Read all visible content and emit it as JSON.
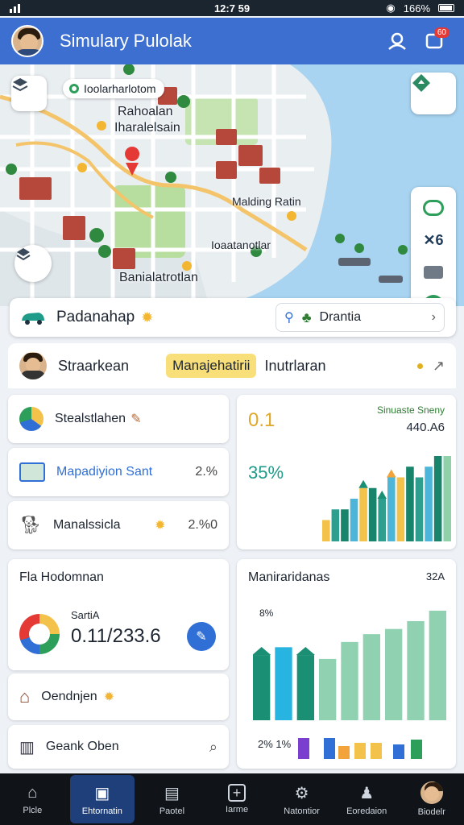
{
  "status": {
    "time": "12:7 59",
    "battery": "166%"
  },
  "header": {
    "title": "Simulary Pulolak",
    "notification_count": "60"
  },
  "map": {
    "chip_label": "Ioolarharlotom",
    "labels": [
      "Rahoalan",
      "Iharalelsain",
      "Malding Ratin",
      "Ioaatanotlar",
      "Banialatrotlan"
    ]
  },
  "location": {
    "name": "Padanahap",
    "destination": "Drantia"
  },
  "profile": {
    "name": "Straarkean",
    "pill": "Manajehatirii",
    "tag": "Inutrlaran"
  },
  "rows": [
    {
      "label": "Stealstlahen",
      "value": ""
    },
    {
      "label": "Mapadiyion Sant",
      "value": "2.%"
    },
    {
      "label": "Manalssicla",
      "value": "2.%0"
    }
  ],
  "stats_card": {
    "value": "0.1",
    "legend_label": "Sinuaste Sneny",
    "legend_value": "440.A6",
    "percent": "35%"
  },
  "summary_card": {
    "title": "Fla Hodomnan",
    "sublabel": "SartiA",
    "value": "0.11/233.6"
  },
  "list_items": [
    {
      "label": "Oendnjen"
    },
    {
      "label": "Geank Oben"
    }
  ],
  "chart_card": {
    "title": "Maniraridanas",
    "corner": "32A",
    "top_label": "8%",
    "bottom_label": "2% 1%"
  },
  "chart_data": [
    {
      "type": "bar",
      "series": [
        {
          "values": [
            2,
            3,
            3,
            4,
            5,
            5,
            4,
            6,
            6,
            7,
            6,
            7,
            8,
            8
          ]
        }
      ],
      "colors": [
        "#f2c24b",
        "#2e9e8f",
        "#18846b",
        "#4db6d8",
        "#f2c24b",
        "#18846b",
        "#2e9e8f",
        "#4db6d8",
        "#f2c24b",
        "#18846b",
        "#2e9e8f",
        "#4db6d8",
        "#18846b",
        "#8fd1a9"
      ]
    },
    {
      "type": "bar",
      "series": [
        {
          "values": [
            5,
            5.6,
            5,
            4.7,
            6,
            6.6,
            7,
            7.6,
            8.4
          ]
        }
      ],
      "colors": [
        "#1b8f74",
        "#28b4e0",
        "#1b8f74",
        "#8fd1b0",
        "#8fd1b0",
        "#8fd1b0",
        "#8fd1b0",
        "#8fd1b0",
        "#8fd1b0"
      ]
    }
  ],
  "nav": [
    {
      "label": "Plcle"
    },
    {
      "label": "Ehtornatin"
    },
    {
      "label": "Paotel"
    },
    {
      "label": "Iarme"
    },
    {
      "label": "Natontior"
    },
    {
      "label": "Eoredaion"
    },
    {
      "label": "Biodelr"
    }
  ],
  "colors": {
    "appbar": "#3d6fd0",
    "accent": "#2f6fd6",
    "pill": "#f8df7a"
  }
}
